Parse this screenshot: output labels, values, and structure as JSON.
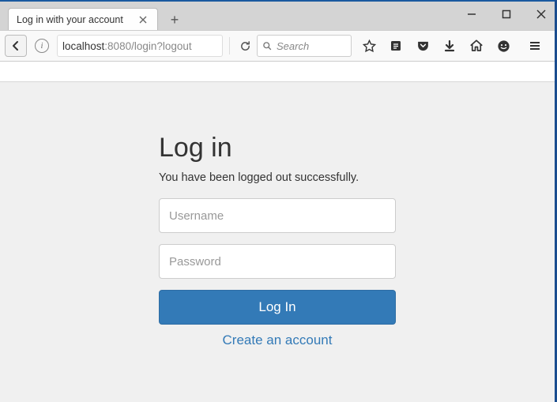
{
  "browser": {
    "tab": {
      "title": "Log in with your account"
    },
    "url": {
      "host": "localhost",
      "port_path": ":8080/login?logout"
    },
    "search": {
      "placeholder": "Search"
    }
  },
  "login": {
    "title": "Log in",
    "message": "You have been logged out successfully.",
    "username_placeholder": "Username",
    "password_placeholder": "Password",
    "submit_label": "Log In",
    "create_account_label": "Create an account"
  }
}
